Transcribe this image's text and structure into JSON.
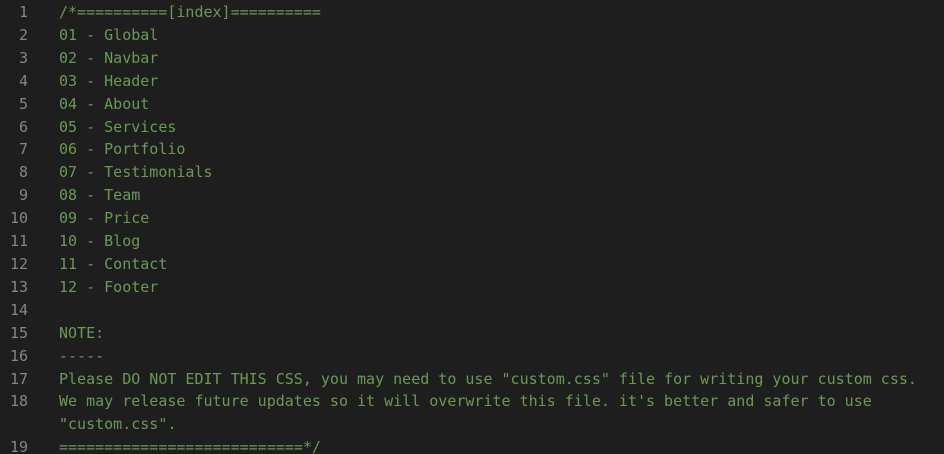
{
  "editor": {
    "lines": [
      {
        "num": "1",
        "text": "/*==========[index]=========="
      },
      {
        "num": "2",
        "text": "01 - Global"
      },
      {
        "num": "3",
        "text": "02 - Navbar"
      },
      {
        "num": "4",
        "text": "03 - Header"
      },
      {
        "num": "5",
        "text": "04 - About"
      },
      {
        "num": "6",
        "text": "05 - Services"
      },
      {
        "num": "7",
        "text": "06 - Portfolio"
      },
      {
        "num": "8",
        "text": "07 - Testimonials"
      },
      {
        "num": "9",
        "text": "08 - Team"
      },
      {
        "num": "10",
        "text": "09 - Price"
      },
      {
        "num": "11",
        "text": "10 - Blog"
      },
      {
        "num": "12",
        "text": "11 - Contact"
      },
      {
        "num": "13",
        "text": "12 - Footer"
      },
      {
        "num": "14",
        "text": ""
      },
      {
        "num": "15",
        "text": "NOTE:"
      },
      {
        "num": "16",
        "text": "-----"
      },
      {
        "num": "17",
        "text": "Please DO NOT EDIT THIS CSS, you may need to use \"custom.css\" file for writing your custom css."
      },
      {
        "num": "18",
        "text": "We may release future updates so it will overwrite this file. it's better and safer to use \"custom.css\"."
      },
      {
        "num": "19",
        "text": "===========================*/"
      }
    ]
  },
  "colors": {
    "background": "#1e1e1e",
    "line_number": "#858585",
    "comment": "#6a9955"
  }
}
